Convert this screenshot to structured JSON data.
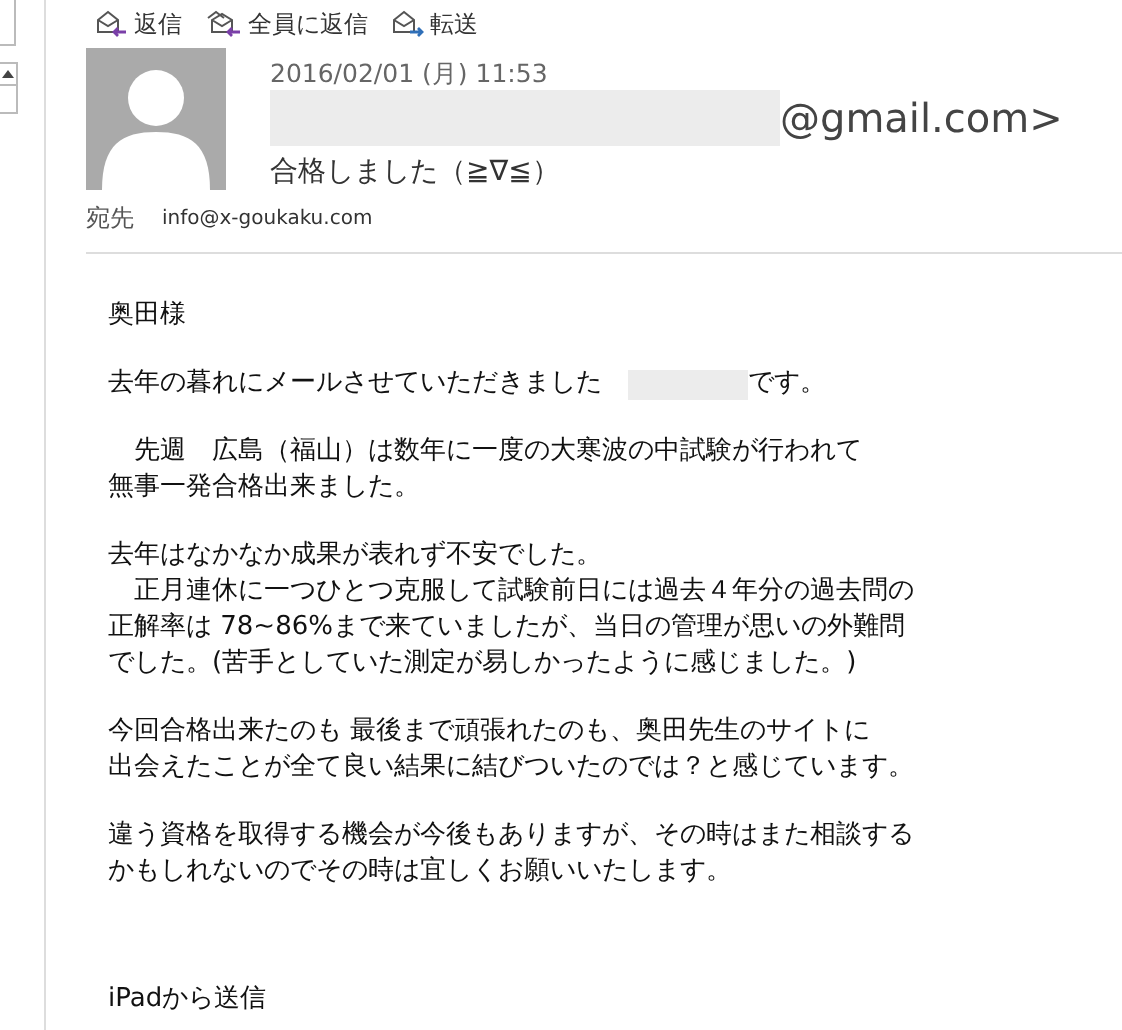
{
  "actions": [
    {
      "kind": "reply",
      "label": "返信"
    },
    {
      "kind": "reply_all",
      "label": "全員に返信"
    },
    {
      "kind": "forward",
      "label": "転送"
    }
  ],
  "header": {
    "date": "2016/02/01 (月) 11:53",
    "sender": "@gmail.com>",
    "subject": "合格しました（≧∇≦）",
    "to_label": "宛先",
    "to": "info@x-goukaku.com"
  },
  "body": [
    [
      [
        {
          "kind": "text",
          "text": "奥田様"
        }
      ]
    ],
    [
      [
        {
          "kind": "text",
          "text": "去年の暮れにメールさせていただきました　"
        },
        {
          "kind": "redacted"
        },
        {
          "kind": "text",
          "text": "です。"
        }
      ]
    ],
    [
      [
        {
          "kind": "text",
          "text": "　先週　広島（福山）は数年に一度の大寒波の中試験が行われて"
        }
      ],
      [
        {
          "kind": "text",
          "text": "無事一発合格出来ました。"
        }
      ]
    ],
    [
      [
        {
          "kind": "text",
          "text": "去年はなかなか成果が表れず不安でした。"
        }
      ],
      [
        {
          "kind": "text",
          "text": "　正月連休に一つひとつ克服して試験前日には過去４年分の過去問の"
        }
      ],
      [
        {
          "kind": "text",
          "text": "正解率は 78~86%まで来ていましたが、当日の管理が思いの外難問"
        }
      ],
      [
        {
          "kind": "text",
          "text": "でした。(苦手としていた測定が易しかったように感じました。)"
        }
      ]
    ],
    [
      [
        {
          "kind": "text",
          "text": "今回合格出来たのも 最後まで頑張れたのも、奥田先生のサイトに"
        }
      ],
      [
        {
          "kind": "text",
          "text": "出会えたことが全て良い結果に結びついたのでは？と感じています。"
        }
      ]
    ],
    [
      [
        {
          "kind": "text",
          "text": "違う資格を取得する機会が今後もありますが、その時はまた相談する"
        }
      ],
      [
        {
          "kind": "text",
          "text": "かもしれないのでその時は宜しくお願いいたします。"
        }
      ]
    ]
  ],
  "signature": "iPadから送信"
}
